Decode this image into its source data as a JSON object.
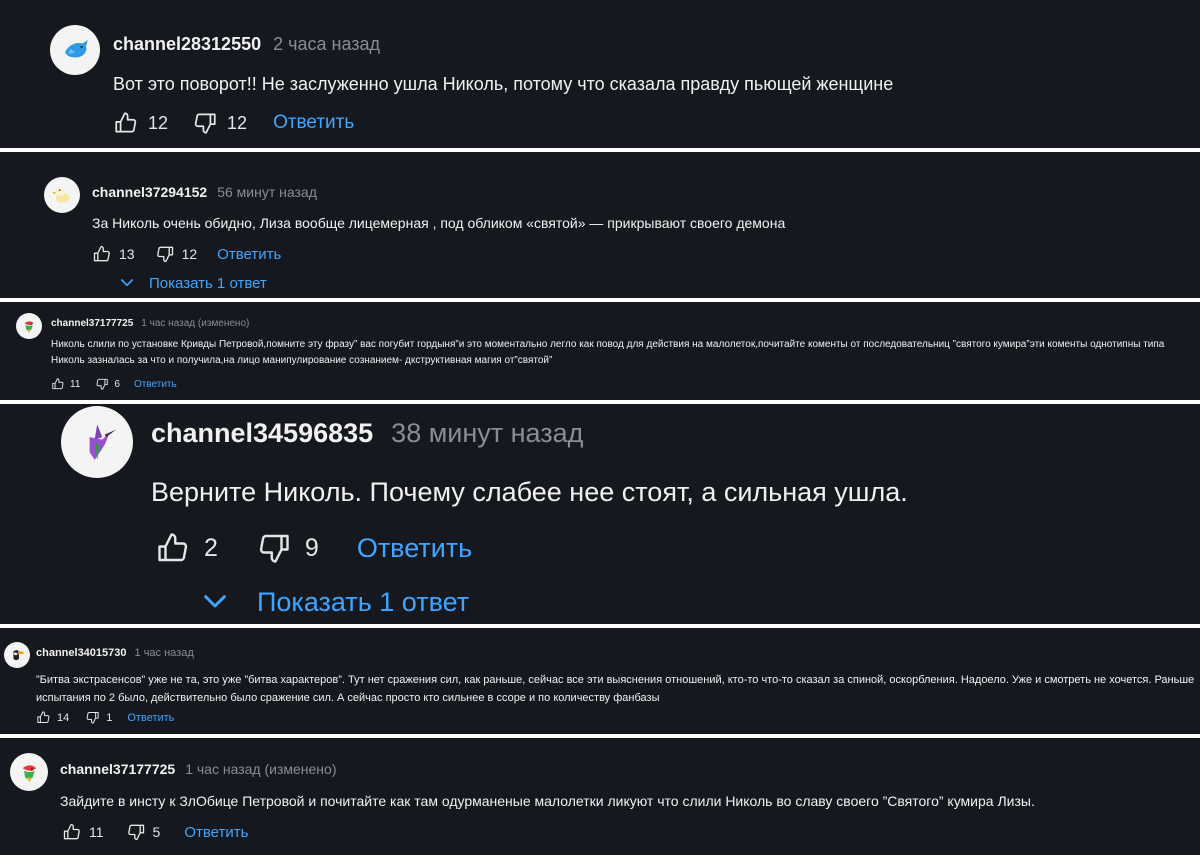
{
  "comments": [
    {
      "author": "channel28312550",
      "time": "2 часа назад",
      "text": "Вот это поворот!! Не заслуженно ушла Николь, потому что сказала правду пьющей женщине",
      "likes": "12",
      "dislikes": "12",
      "reply_label": "Ответить",
      "avatar_icon": "blue-bird-icon"
    },
    {
      "author": "channel37294152",
      "time": "56 минут назад",
      "text": "За Николь очень обидно, Лиза вообще лицемерная , под обликом «святой» — прикрывают своего демона",
      "likes": "13",
      "dislikes": "12",
      "reply_label": "Ответить",
      "show_replies": "Показать 1 ответ",
      "avatar_icon": "duck-icon"
    },
    {
      "author": "channel37177725",
      "time": "1 час назад (изменено)",
      "text": "Николь слили по установке Кривды Петровой,помните эту фразу” вас погубит гордыня”и это моментально легло как повод для действия на малолеток,почитайте коменты от последовательниц ”святого кумира”эти коменты однотипны типа Николь зазналась за что и получила,на лицо манипулирование сознанием- дкструктивная магия от”святой”",
      "likes": "11",
      "dislikes": "6",
      "reply_label": "Ответить",
      "avatar_icon": "parrot-icon"
    },
    {
      "author": "channel34596835",
      "time": "38 минут назад",
      "text": "Верните Николь. Почему слабее нее стоят, а сильная ушла.",
      "likes": "2",
      "dislikes": "9",
      "reply_label": "Ответить",
      "show_replies": "Показать 1 ответ",
      "avatar_icon": "hummingbird-icon"
    },
    {
      "author": "channel34015730",
      "time": "1 час назад",
      "text": "”Битва экстрасенсов” уже не та, это уже ”битва характеров”. Тут нет сражения сил, как раньше, сейчас все эти выяснения отношений, кто-то что-то сказал за спиной, оскорбления. Надоело. Уже и смотреть не хочется. Раньше испытания по 2 было, действительно было сражение сил. А сейчас просто кто сильнее в ссоре и по количеству фанбазы",
      "likes": "14",
      "dislikes": "1",
      "reply_label": "Ответить",
      "avatar_icon": "toucan-icon"
    },
    {
      "author": "channel37177725",
      "time": "1 час назад (изменено)",
      "text": "Зайдите в инсту к ЗлОбице Петровой и почитайте как там одурманеные малолетки ликуют что слили Николь во славу своего ”Святого” кумира Лизы.",
      "likes": "11",
      "dislikes": "5",
      "reply_label": "Ответить",
      "avatar_icon": "parrot-icon"
    }
  ],
  "colors": {
    "background": "#15181f",
    "text": "#f1f1f1",
    "muted": "#8a8d93",
    "link": "#3ea6ff"
  }
}
